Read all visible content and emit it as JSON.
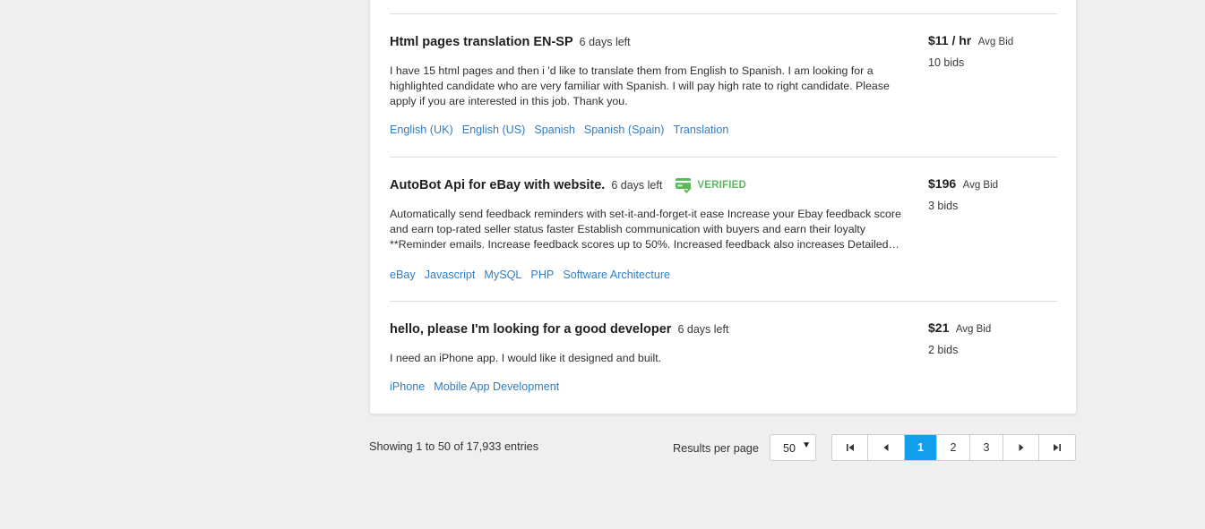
{
  "jobs": [
    {
      "title": "Html pages translation EN-SP",
      "days_left": "6 days left",
      "verified": false,
      "description": "I have 15 html pages and then i 'd like to translate them from English to Spanish. I am looking for a highlighted candidate who are very familiar with Spanish. I will pay high rate to right candidate. Please apply if you are interested in this job. Thank you.",
      "tags": [
        "English (UK)",
        "English (US)",
        "Spanish",
        "Spanish (Spain)",
        "Translation"
      ],
      "price": "$11 / hr",
      "price_label": "Avg Bid",
      "bids": "10 bids"
    },
    {
      "title": "AutoBot Api for eBay with website.",
      "days_left": "6 days left",
      "verified": true,
      "verified_label": "VERIFIED",
      "description": "Automatically send feedback reminders with set-it-and-forget-it ease Increase your Ebay feedback score and earn top-rated seller status faster Establish communication with buyers and earn their loyalty **Reminder emails. Increase feedback scores up to 50%. Increased feedback also increases Detailed…",
      "tags": [
        "eBay",
        "Javascript",
        "MySQL",
        "PHP",
        "Software Architecture"
      ],
      "price": "$196",
      "price_label": "Avg Bid",
      "bids": "3 bids"
    },
    {
      "title": "hello, please I'm looking for a good developer",
      "days_left": "6 days left",
      "verified": false,
      "description": "I need an iPhone app. I would like it designed and built.",
      "tags": [
        "iPhone",
        "Mobile App Development"
      ],
      "price": "$21",
      "price_label": "Avg Bid",
      "bids": "2 bids"
    }
  ],
  "footer": {
    "showing": "Showing 1 to 50 of 17,933 entries",
    "results_per_page_label": "Results per page",
    "results_per_page_value": "50",
    "pages": [
      "1",
      "2",
      "3"
    ],
    "active_page": "1"
  },
  "colors": {
    "link": "#2f7ec4",
    "verified": "#5cb85c",
    "active_page": "#139ff0",
    "background": "#efefef"
  }
}
